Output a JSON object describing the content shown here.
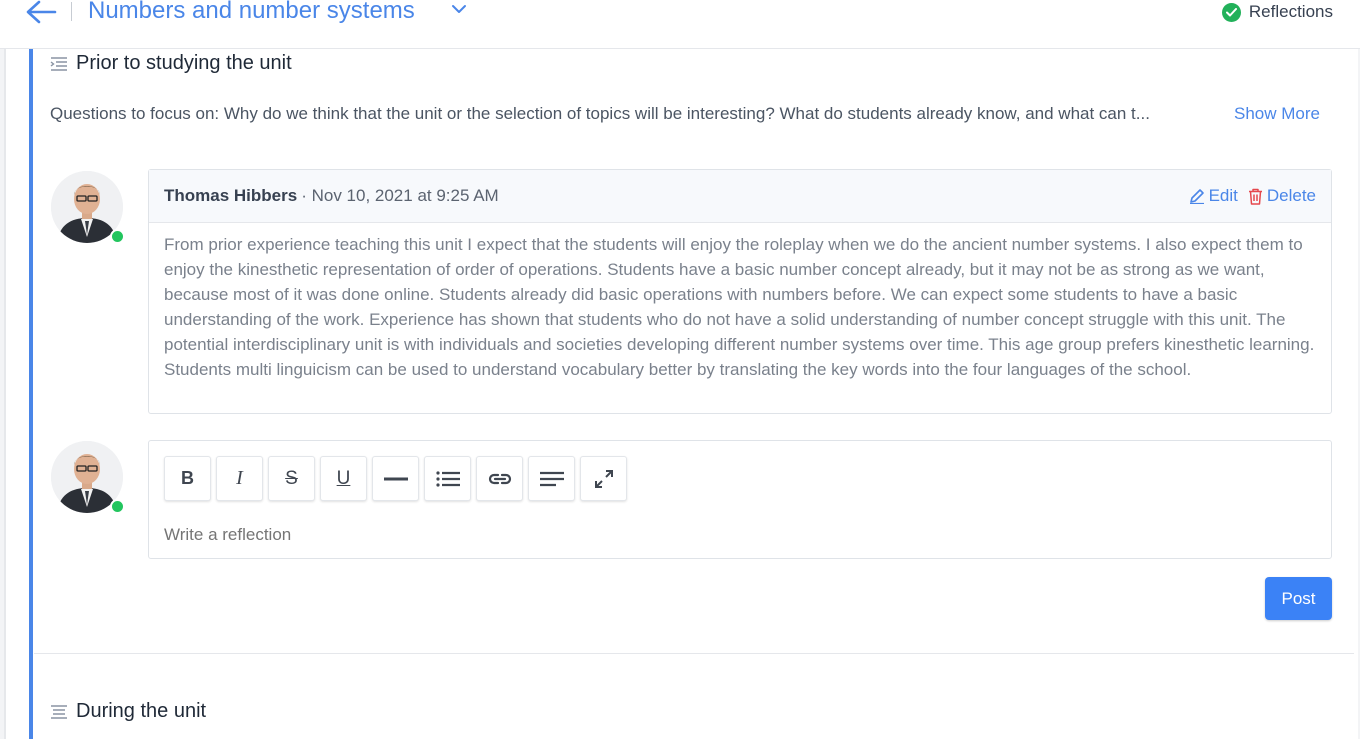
{
  "header": {
    "title": "Numbers and number systems",
    "status_label": "Reflections",
    "colors": {
      "accent": "#4a86e8",
      "status": "#22b15a"
    }
  },
  "sections": [
    {
      "title": "Prior to studying the unit"
    },
    {
      "title": "During the unit"
    }
  ],
  "questions": {
    "text": "Questions to focus on: Why do we think that the unit or the selection of topics will be interesting? What do students already know, and what can t...",
    "show_more": "Show More"
  },
  "comment": {
    "author": "Thomas Hibbers",
    "meta": "· Nov 10, 2021 at 9:25 AM",
    "edit_label": "Edit",
    "delete_label": "Delete",
    "body": "From prior experience teaching this unit I expect that the students will enjoy the roleplay when we do the ancient number systems. I also expect them to enjoy the kinesthetic representation of order of operations. Students have a basic number concept already, but it may not be as strong as we want, because most of it was done online. Students already did basic operations with numbers before. We can expect some students to have a basic understanding of the work. Experience has shown that students who do not have a solid understanding of number concept struggle with this unit. The potential interdisciplinary unit is with individuals and societies developing different number systems over time. This age group prefers kinesthetic learning. Students multi linguicism can be used to understand vocabulary better by translating the key words into the four languages of the school."
  },
  "editor": {
    "toolbar": [
      {
        "icon": "bold-icon",
        "label": "B"
      },
      {
        "icon": "italic-icon",
        "label": "I"
      },
      {
        "icon": "strikethrough-icon",
        "label": "S"
      },
      {
        "icon": "underline-icon",
        "label": "U"
      },
      {
        "icon": "horizontal-rule-icon"
      },
      {
        "icon": "bullet-list-icon"
      },
      {
        "icon": "link-icon"
      },
      {
        "icon": "align-left-icon"
      },
      {
        "icon": "fullscreen-icon"
      }
    ],
    "placeholder": "Write a reflection",
    "post_label": "Post"
  }
}
